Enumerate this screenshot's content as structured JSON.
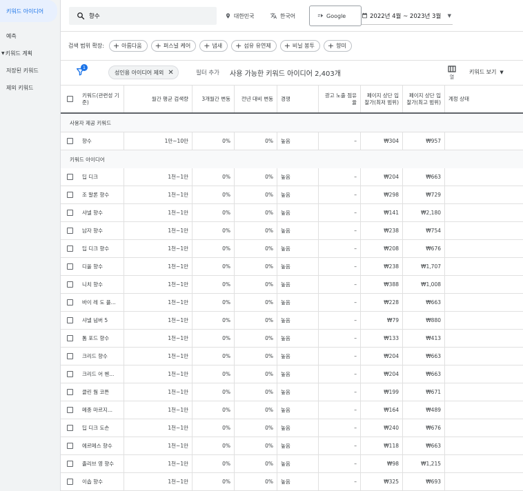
{
  "sidebar": {
    "items": [
      {
        "label": "키워드 아이디어"
      },
      {
        "label": "예측"
      },
      {
        "label": "키워드 계획"
      },
      {
        "label": "저장된 키워드"
      },
      {
        "label": "제외 키워드"
      }
    ]
  },
  "topbar": {
    "search_value": "향수",
    "location": "대한민국",
    "language": "한국어",
    "network": "Google",
    "date_range": "2022년 4월 ~ 2023년 3월"
  },
  "expand": {
    "label": "검색 범위 확장:",
    "pills": [
      "아름다움",
      "퍼스널 케어",
      "냄새",
      "섬유 유연제",
      "비닐 봉투",
      "향미"
    ]
  },
  "filter": {
    "badge_count": "1",
    "chip_label": "성인용 아이디어 제외",
    "add_filter": "필터 추가",
    "available": "사용 가능한 키워드 아이디어 2,403개",
    "columns_label": "열",
    "view_keywords": "키워드 보기"
  },
  "table": {
    "headers": {
      "keyword": "키워드(관련성 기준)",
      "monthly": "월간 평균 검색량",
      "three_month": "3개월간 변동",
      "yoy": "전년 대비 변동",
      "competition": "경쟁",
      "impression_share": "광고 노출 점유율",
      "bid_low": "페이지 상단 입찰가(최저 범위)",
      "bid_high": "페이지 상단 입찰가(최고 범위)",
      "account_status": "계정 상태"
    },
    "section_provided": "사용자 제공 키워드",
    "section_ideas": "키워드 아이디어",
    "provided_rows": [
      {
        "keyword": "향수",
        "monthly": "1만~10만",
        "three_month": "0%",
        "yoy": "0%",
        "competition": "높음",
        "impression_share": "–",
        "bid_low": "₩304",
        "bid_high": "₩957"
      }
    ],
    "idea_rows": [
      {
        "keyword": "딥 디크",
        "monthly": "1천~1만",
        "three_month": "0%",
        "yoy": "0%",
        "competition": "높음",
        "impression_share": "–",
        "bid_low": "₩204",
        "bid_high": "₩663"
      },
      {
        "keyword": "조 말론 향수",
        "monthly": "1천~1만",
        "three_month": "0%",
        "yoy": "0%",
        "competition": "높음",
        "impression_share": "–",
        "bid_low": "₩298",
        "bid_high": "₩729"
      },
      {
        "keyword": "샤넬 향수",
        "monthly": "1천~1만",
        "three_month": "0%",
        "yoy": "0%",
        "competition": "높음",
        "impression_share": "–",
        "bid_low": "₩141",
        "bid_high": "₩2,180"
      },
      {
        "keyword": "남자 향수",
        "monthly": "1천~1만",
        "three_month": "0%",
        "yoy": "0%",
        "competition": "높음",
        "impression_share": "–",
        "bid_low": "₩238",
        "bid_high": "₩754"
      },
      {
        "keyword": "딥 디크 향수",
        "monthly": "1천~1만",
        "three_month": "0%",
        "yoy": "0%",
        "competition": "높음",
        "impression_share": "–",
        "bid_low": "₩208",
        "bid_high": "₩676"
      },
      {
        "keyword": "디올 향수",
        "monthly": "1천~1만",
        "three_month": "0%",
        "yoy": "0%",
        "competition": "높음",
        "impression_share": "–",
        "bid_low": "₩238",
        "bid_high": "₩1,707"
      },
      {
        "keyword": "니치 향수",
        "monthly": "1천~1만",
        "three_month": "0%",
        "yoy": "0%",
        "competition": "높음",
        "impression_share": "–",
        "bid_low": "₩388",
        "bid_high": "₩1,008"
      },
      {
        "keyword": "바이 레 도 플...",
        "monthly": "1천~1만",
        "three_month": "0%",
        "yoy": "0%",
        "competition": "높음",
        "impression_share": "–",
        "bid_low": "₩228",
        "bid_high": "₩663"
      },
      {
        "keyword": "샤넬 넘버 5",
        "monthly": "1천~1만",
        "three_month": "0%",
        "yoy": "0%",
        "competition": "높음",
        "impression_share": "–",
        "bid_low": "₩79",
        "bid_high": "₩880"
      },
      {
        "keyword": "톰 포드 향수",
        "monthly": "1천~1만",
        "three_month": "0%",
        "yoy": "0%",
        "competition": "높음",
        "impression_share": "–",
        "bid_low": "₩133",
        "bid_high": "₩413"
      },
      {
        "keyword": "크리드 향수",
        "monthly": "1천~1만",
        "three_month": "0%",
        "yoy": "0%",
        "competition": "높음",
        "impression_share": "–",
        "bid_low": "₩204",
        "bid_high": "₩663"
      },
      {
        "keyword": "크리드 어 벤...",
        "monthly": "1천~1만",
        "three_month": "0%",
        "yoy": "0%",
        "competition": "높음",
        "impression_share": "–",
        "bid_low": "₩204",
        "bid_high": "₩663"
      },
      {
        "keyword": "클린 웜 코튼",
        "monthly": "1천~1만",
        "three_month": "0%",
        "yoy": "0%",
        "competition": "높음",
        "impression_share": "–",
        "bid_low": "₩199",
        "bid_high": "₩671"
      },
      {
        "keyword": "메종 마르지...",
        "monthly": "1천~1만",
        "three_month": "0%",
        "yoy": "0%",
        "competition": "높음",
        "impression_share": "–",
        "bid_low": "₩164",
        "bid_high": "₩489"
      },
      {
        "keyword": "딥 디크 도손",
        "monthly": "1천~1만",
        "three_month": "0%",
        "yoy": "0%",
        "competition": "높음",
        "impression_share": "–",
        "bid_low": "₩240",
        "bid_high": "₩676"
      },
      {
        "keyword": "에르메스 향수",
        "monthly": "1천~1만",
        "three_month": "0%",
        "yoy": "0%",
        "competition": "높음",
        "impression_share": "–",
        "bid_low": "₩118",
        "bid_high": "₩663"
      },
      {
        "keyword": "졸리브 영 향수",
        "monthly": "1천~1만",
        "three_month": "0%",
        "yoy": "0%",
        "competition": "높음",
        "impression_share": "–",
        "bid_low": "₩98",
        "bid_high": "₩1,215"
      },
      {
        "keyword": "이솝 향수",
        "monthly": "1천~1만",
        "three_month": "0%",
        "yoy": "0%",
        "competition": "높음",
        "impression_share": "–",
        "bid_low": "₩325",
        "bid_high": "₩693"
      }
    ]
  }
}
